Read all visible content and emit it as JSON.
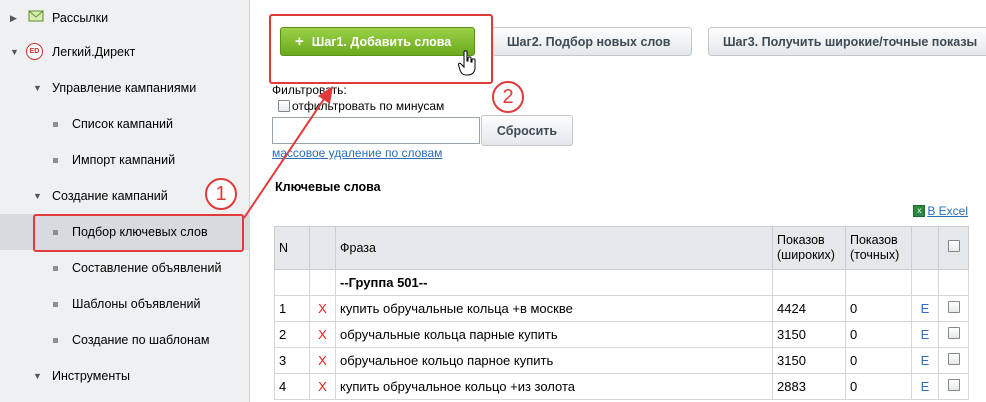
{
  "sidebar": {
    "items": [
      {
        "label": "Рассылки",
        "type": "section",
        "icon": "mail-icon"
      },
      {
        "label": "Легкий.Директ",
        "type": "section",
        "icon": "ed-icon",
        "icon_text": "ED"
      },
      {
        "label": "Управление кампаниями",
        "type": "group"
      },
      {
        "label": "Список кампаний",
        "type": "leaf"
      },
      {
        "label": "Импорт кампаний",
        "type": "leaf"
      },
      {
        "label": "Создание кампаний",
        "type": "group"
      },
      {
        "label": "Подбор ключевых слов",
        "type": "leaf",
        "active": true
      },
      {
        "label": "Составление объявлений",
        "type": "leaf"
      },
      {
        "label": "Шаблоны объявлений",
        "type": "leaf"
      },
      {
        "label": "Создание по шаблонам",
        "type": "leaf"
      },
      {
        "label": "Инструменты",
        "type": "group"
      }
    ]
  },
  "steps": {
    "step1": "Шаг1. Добавить слова",
    "step2": "Шаг2. Подбор новых слов",
    "step3": "Шаг3. Получить широкие/точные показы"
  },
  "filter": {
    "label": "Фильтровать:",
    "checkbox_label": "отфильтровать по минусам",
    "input_value": "",
    "reset_label": "Сбросить",
    "mass_delete_link": "массовое удаление по словам"
  },
  "keywords": {
    "title": "Ключевые слова",
    "excel_link": "В Excel",
    "columns": {
      "n": "N",
      "phrase": "Фраза",
      "broad_line1": "Показов",
      "broad_line2": "(широких)",
      "exact_line1": "Показов",
      "exact_line2": "(точных)"
    },
    "group_label": "--Группа 501--",
    "rows": [
      {
        "n": "1",
        "x": "X",
        "phrase": "купить обручальные кольца +в москве",
        "broad": "4424",
        "exact": "0",
        "e": "E"
      },
      {
        "n": "2",
        "x": "X",
        "phrase": "обручальные кольца парные купить",
        "broad": "3150",
        "exact": "0",
        "e": "E"
      },
      {
        "n": "3",
        "x": "X",
        "phrase": "обручальное кольцо парное купить",
        "broad": "3150",
        "exact": "0",
        "e": "E"
      },
      {
        "n": "4",
        "x": "X",
        "phrase": "купить обручальное кольцо +из золота",
        "broad": "2883",
        "exact": "0",
        "e": "E"
      }
    ]
  },
  "annotations": {
    "circle1": "1",
    "circle2": "2",
    "color": "#e03a3a"
  },
  "colors": {
    "accent_green": "#7dbb2a",
    "link_blue": "#2a6fb8",
    "delete_red": "#d22"
  }
}
